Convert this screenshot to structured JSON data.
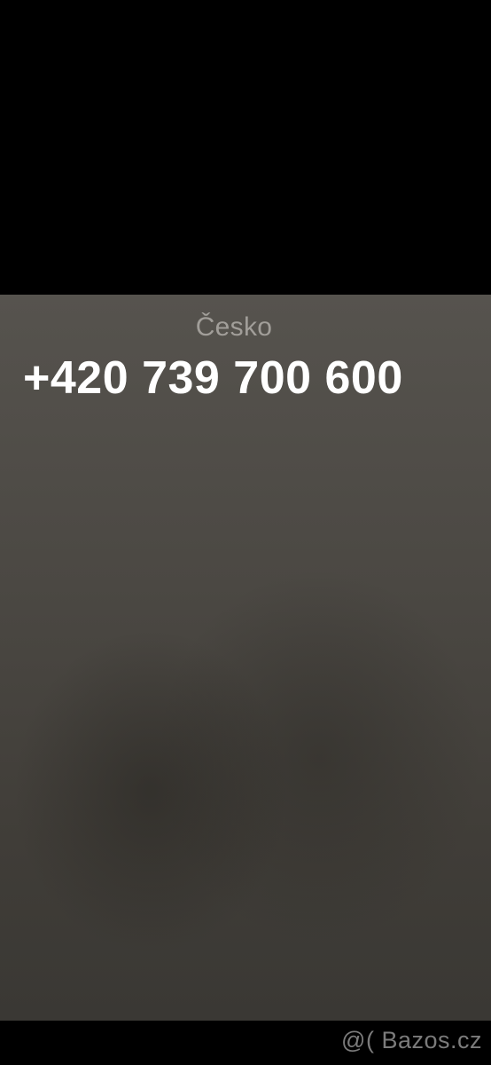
{
  "call": {
    "country": "Česko",
    "phone_number": "+420 739 700 600"
  },
  "watermark": {
    "text": "@( Bazos.cz"
  },
  "colors": {
    "top_bar": "#000000",
    "background_top": "#56534e",
    "background_bottom": "#3a3834",
    "country_text": "#a19e99",
    "number_text": "#ffffff",
    "watermark_text": "#7b7b7b"
  }
}
